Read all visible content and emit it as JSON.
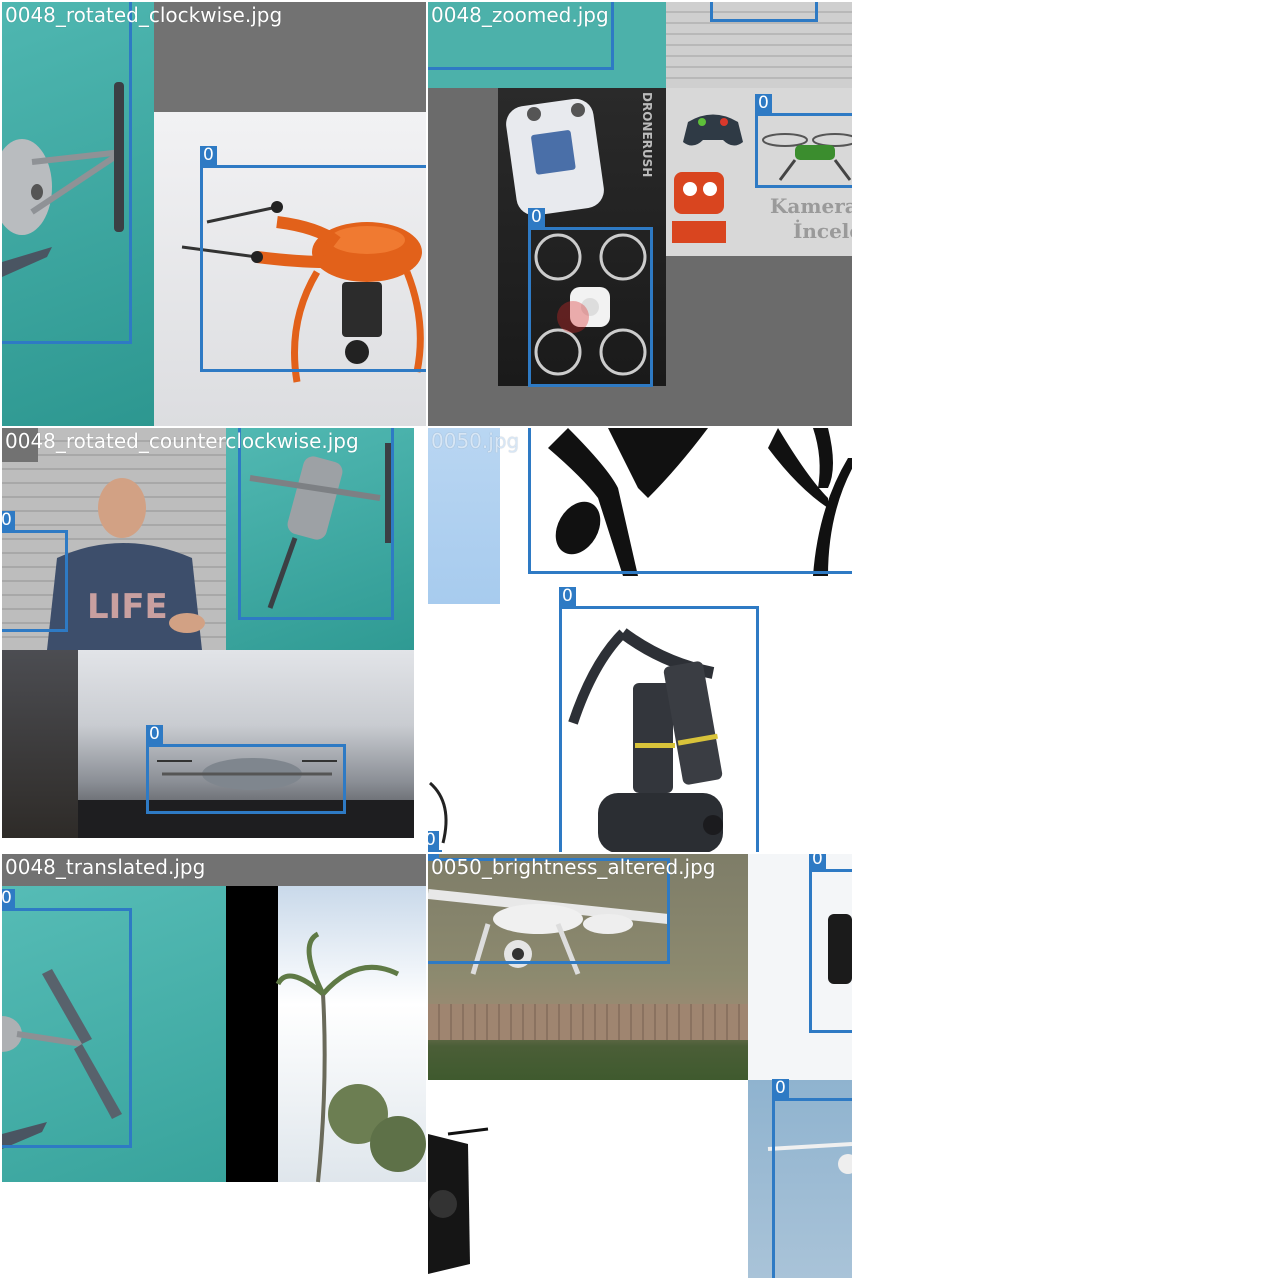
{
  "mosaic": {
    "tiles": [
      {
        "label": "0048_rotated_clockwise.jpg"
      },
      {
        "label": "0048_zoomed.jpg"
      },
      {
        "label": "0048_rotated_counterclockwise.jpg"
      },
      {
        "label": "0050.jpg"
      },
      {
        "label": "0048_translated.jpg"
      },
      {
        "label": "0050_brightness_altered.jpg"
      }
    ],
    "class_id": "0",
    "overlay_texts": {
      "dronerush": "DRONERUSH",
      "kamera": "Kamerali",
      "inceleme": "İncele",
      "life": "LIFE"
    }
  },
  "colors": {
    "box": "#2e7ac4",
    "teal": "#3aa7a2",
    "gray_pad": "#727272",
    "orange": "#e2611a"
  }
}
